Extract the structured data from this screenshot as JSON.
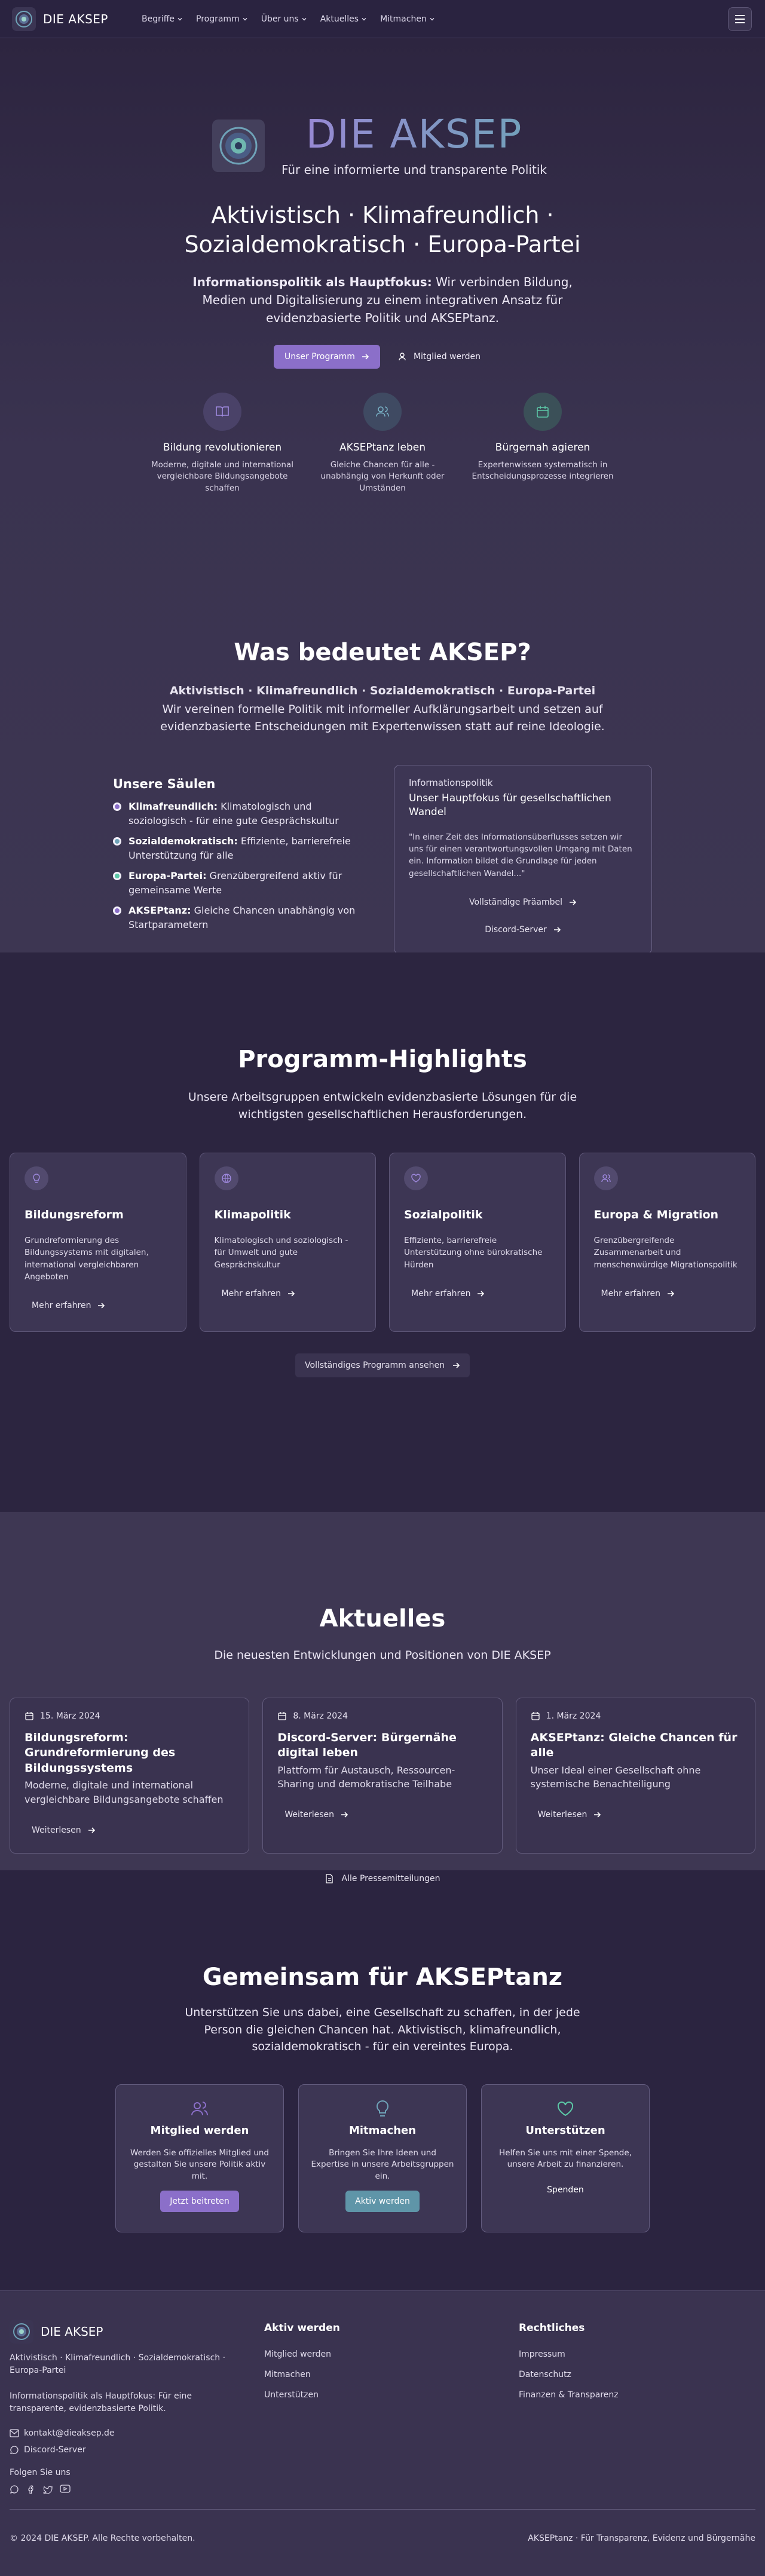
{
  "nav": {
    "brand": "DIE AKSEP",
    "menu": [
      "Begriffe",
      "Programm",
      "Über uns",
      "Aktuelles",
      "Mitmachen"
    ]
  },
  "hero": {
    "title": "DIE AKSEP",
    "subtitle": "Für eine informierte und transparente Politik",
    "tagline_1": "Aktivistisch · Klimafreundlich ·",
    "tagline_2": "Sozialdemokratisch · Europa-Partei",
    "info_bold": "Informationspolitik als Hauptfokus:",
    "info_text": " Wir verbinden Bildung, Medien und Digitalisierung zu einem integrativen Ansatz für evidenzbasierte Politik und AKSEPtanz.",
    "btn_program": "Unser Programm",
    "btn_member": "Mitglied werden",
    "features": [
      {
        "title": "Bildung revolutionieren",
        "desc": "Moderne, digitale und international vergleichbare Bildungsangebote schaffen",
        "icon": "book-icon",
        "color": "#8b6fc9"
      },
      {
        "title": "AKSEPtanz leben",
        "desc": "Gleiche Chancen für alle - unabhängig von Herkunft oder Umständen",
        "icon": "users-icon",
        "color": "#6fa3b8"
      },
      {
        "title": "Bürgernah agieren",
        "desc": "Expertenwissen systematisch in Entscheidungsprozesse integrieren",
        "icon": "calendar-icon",
        "color": "#5cc9a7"
      }
    ]
  },
  "meaning": {
    "title": "Was bedeutet AKSEP?",
    "bold": "Aktivistisch · Klimafreundlich · Sozialdemokratisch · Europa-Partei",
    "desc": "Wir vereinen formelle Politik mit informeller Aufklärungsarbeit und setzen auf evidenzbasierte Entscheidungen mit Expertenwissen statt auf reine Ideologie.",
    "pillars_title": "Unsere Säulen",
    "pillars": [
      {
        "name": "Klimafreundlich:",
        "text": " Klimatologisch und soziologisch - für eine gute Gesprächskultur",
        "color": "#8b6fc9"
      },
      {
        "name": "Sozialdemokratisch:",
        "text": " Effiziente, barrierefreie Unterstützung für alle",
        "color": "#6fa3b8"
      },
      {
        "name": "Europa-Partei:",
        "text": " Grenzübergreifend aktiv für gemeinsame Werte",
        "color": "#5cc9a7"
      },
      {
        "name": "AKSEPtanz:",
        "text": " Gleiche Chancen unabhängig von Startparametern",
        "color": "#8b6fc9"
      }
    ],
    "box": {
      "label": "Informationspolitik",
      "title": "Unser Hauptfokus für gesellschaftlichen Wandel",
      "quote": "\"In einer Zeit des Informationsüberflusses setzen wir uns für einen verantwortungsvollen Umgang mit Daten ein. Information bildet die Grundlage für jeden gesellschaftlichen Wandel...\"",
      "btn_preamble": "Vollständige Präambel",
      "btn_discord": "Discord-Server"
    }
  },
  "program": {
    "title": "Programm-Highlights",
    "subtitle": "Unsere Arbeitsgruppen entwickeln evidenzbasierte Lösungen für die wichtigsten gesellschaftlichen Herausforderungen.",
    "cards": [
      {
        "title": "Bildungsreform",
        "desc": "Grundreformierung des Bildungssystems mit digitalen, international vergleichbaren Angeboten",
        "link": "Mehr erfahren",
        "icon": "lightbulb-icon"
      },
      {
        "title": "Klimapolitik",
        "desc": "Klimatologisch und soziologisch - für Umwelt und gute Gesprächskultur",
        "link": "Mehr erfahren",
        "icon": "globe-icon"
      },
      {
        "title": "Sozialpolitik",
        "desc": "Effiziente, barrierefreie Unterstützung ohne bürokratische Hürden",
        "link": "Mehr erfahren",
        "icon": "heart-icon"
      },
      {
        "title": "Europa & Migration",
        "desc": "Grenzübergreifende Zusammenarbeit und menschenwürdige Migrationspolitik",
        "link": "Mehr erfahren",
        "icon": "users-icon"
      }
    ],
    "all_btn": "Vollständiges Programm ansehen"
  },
  "news": {
    "title": "Aktuelles",
    "subtitle": "Die neuesten Entwicklungen und Positionen von DIE AKSEP",
    "items": [
      {
        "date": "15. März 2024",
        "title": "Bildungsreform: Grundreformierung des Bildungssystems",
        "desc": "Moderne, digitale und international vergleichbare Bildungsangebote schaffen",
        "link": "Weiterlesen"
      },
      {
        "date": "8. März 2024",
        "title": "Discord-Server: Bürgernähe digital leben",
        "desc": "Plattform für Austausch, Ressourcen-Sharing und demokratische Teilhabe",
        "link": "Weiterlesen"
      },
      {
        "date": "1. März 2024",
        "title": "AKSEPtanz: Gleiche Chancen für alle",
        "desc": "Unser Ideal einer Gesellschaft ohne systemische Benachteiligung",
        "link": "Weiterlesen"
      }
    ],
    "press": "Alle Pressemitteilungen"
  },
  "join": {
    "title": "Gemeinsam für AKSEPtanz",
    "subtitle": "Unterstützen Sie uns dabei, eine Gesellschaft zu schaffen, in der jede Person die gleichen Chancen hat. Aktivistisch, klimafreundlich, sozialdemokratisch - für ein vereintes Europa.",
    "cards": [
      {
        "title": "Mitglied werden",
        "desc": "Werden Sie offizielles Mitglied und gestalten Sie unsere Politik aktiv mit.",
        "btn": "Jetzt beitreten",
        "icon": "users-icon",
        "color": "#8b6fc9"
      },
      {
        "title": "Mitmachen",
        "desc": "Bringen Sie Ihre Ideen und Expertise in unsere Arbeitsgruppen ein.",
        "btn": "Aktiv werden",
        "icon": "lightbulb-icon",
        "color": "#6fa3b8"
      },
      {
        "title": "Unterstützen",
        "desc": "Helfen Sie uns mit einer Spende, unsere Arbeit zu finanzieren.",
        "btn": "Spenden",
        "icon": "heart-icon",
        "color": "#5cc9a7"
      }
    ]
  },
  "footer": {
    "brand": "DIE AKSEP",
    "tagline": "Aktivistisch · Klimafreundlich · Sozialdemokratisch · Europa-Partei",
    "info": "Informationspolitik als Hauptfokus: Für eine transparente, evidenzbasierte Politik.",
    "email": "kontakt@dieaksep.de",
    "discord": "Discord-Server",
    "follow": "Folgen Sie uns",
    "col2_title": "Aktiv werden",
    "col2_links": [
      "Mitglied werden",
      "Mitmachen",
      "Unterstützen"
    ],
    "col3_title": "Rechtliches",
    "col3_links": [
      "Impressum",
      "Datenschutz",
      "Finanzen & Transparenz"
    ],
    "copyright": "© 2024 DIE AKSEP. Alle Rechte vorbehalten.",
    "slogan": "AKSEPtanz · Für Transparenz, Evidenz und Bürgernähe"
  }
}
